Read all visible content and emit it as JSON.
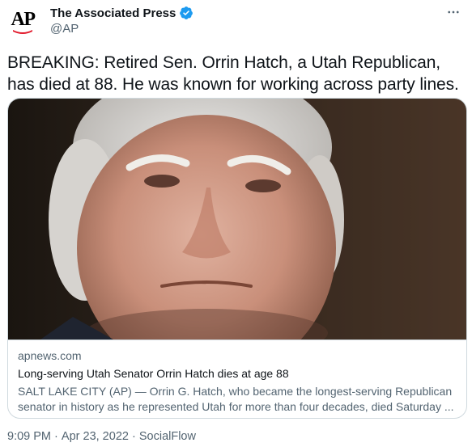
{
  "account": {
    "display_name": "The Associated Press",
    "handle": "@AP",
    "avatar_text": "AP",
    "verified": true,
    "brand_color": "#e21c2e",
    "verified_color": "#1d9bf0"
  },
  "tweet": {
    "text": "BREAKING: Retired Sen. Orrin Hatch, a Utah Republican, has died at 88. He was known for working across party lines."
  },
  "card": {
    "domain": "apnews.com",
    "title": "Long-serving Utah Senator Orrin Hatch dies at age 88",
    "description": "SALT LAKE CITY (AP) — Orrin G. Hatch, who became the longest-serving Republican senator in history as he represented Utah for more than four decades, died Saturday ..."
  },
  "meta": {
    "time": "9:09 PM",
    "separator": "·",
    "date": "Apr 23, 2022",
    "source": "SocialFlow"
  },
  "icons": {
    "more": "more-horizontal-icon",
    "verified": "verified-badge-icon"
  }
}
